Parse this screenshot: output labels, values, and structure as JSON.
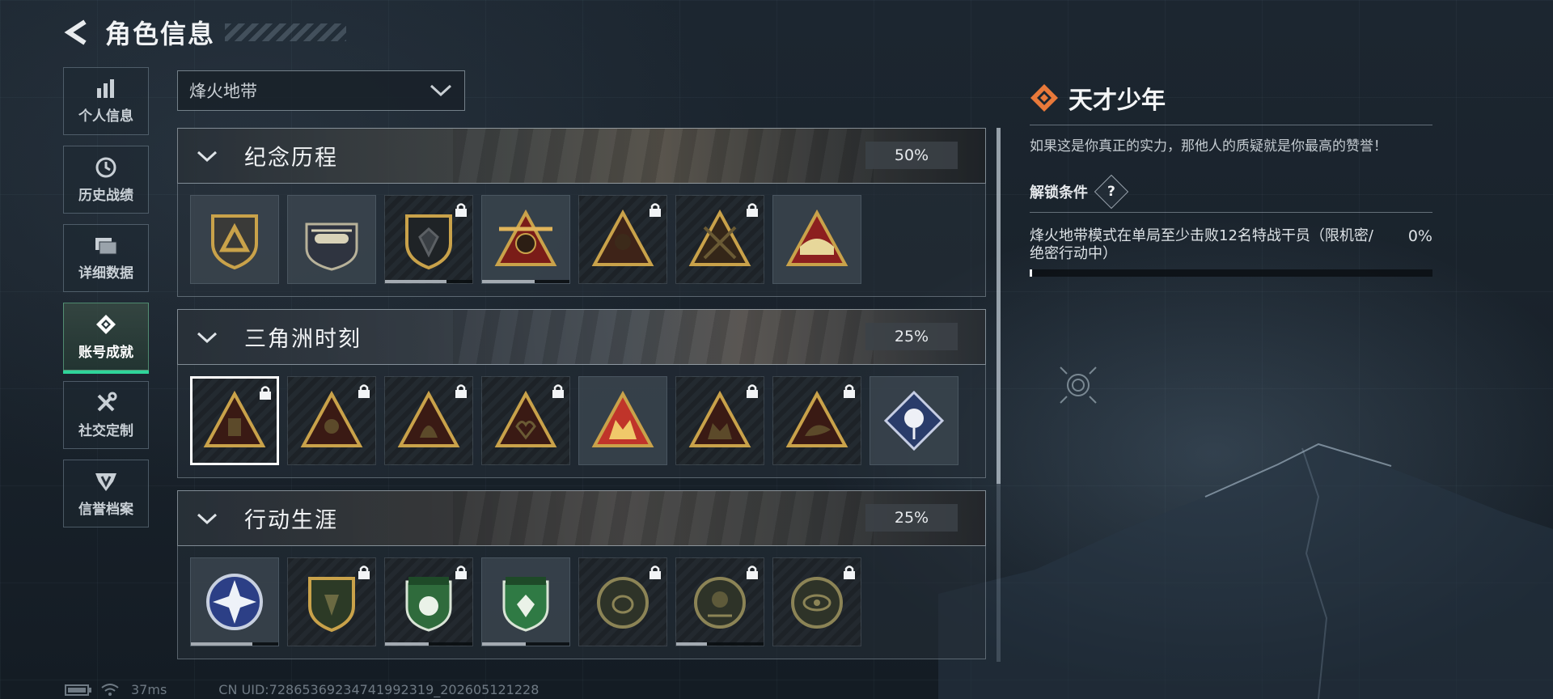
{
  "header": {
    "title": "角色信息"
  },
  "sidebar": {
    "items": [
      {
        "label": "个人信息",
        "icon": "bar-chart-icon",
        "active": false
      },
      {
        "label": "历史战绩",
        "icon": "clock-icon",
        "active": false
      },
      {
        "label": "详细数据",
        "icon": "folder-icon",
        "active": false
      },
      {
        "label": "账号成就",
        "icon": "achievement-icon",
        "active": true
      },
      {
        "label": "社交定制",
        "icon": "tools-icon",
        "active": false
      },
      {
        "label": "信誉档案",
        "icon": "shield-emblem-icon",
        "active": false
      }
    ]
  },
  "mode_select": {
    "value": "烽火地带"
  },
  "sections": [
    {
      "title": "纪念历程",
      "percent": "50%",
      "badges": [
        {
          "emblem": "triangle-shield-emblem",
          "locked": false,
          "progress": 0
        },
        {
          "emblem": "helicopter-emblem",
          "locked": false,
          "progress": 0
        },
        {
          "emblem": "hex-shield-emblem",
          "locked": true,
          "progress": 0.7
        },
        {
          "emblem": "wing-59-emblem",
          "locked": false,
          "progress": 0.6
        },
        {
          "emblem": "operator-portrait-emblem",
          "locked": true,
          "progress": 0
        },
        {
          "emblem": "crossed-swords-emblem",
          "locked": true,
          "progress": 0
        },
        {
          "emblem": "stacked-sandbags-emblem",
          "locked": false,
          "progress": 0
        }
      ]
    },
    {
      "title": "三角洲时刻",
      "percent": "25%",
      "badges": [
        {
          "emblem": "delta-portrait-emblem",
          "locked": true,
          "progress": 0,
          "selected": true
        },
        {
          "emblem": "delta-skull-emblem",
          "locked": true,
          "progress": 0
        },
        {
          "emblem": "delta-figure-emblem",
          "locked": true,
          "progress": 0
        },
        {
          "emblem": "delta-heart-emblem",
          "locked": true,
          "progress": 0
        },
        {
          "emblem": "delta-team-gold-emblem",
          "locked": false,
          "progress": 0
        },
        {
          "emblem": "delta-soldiers-emblem",
          "locked": true,
          "progress": 0
        },
        {
          "emblem": "delta-beast-emblem",
          "locked": true,
          "progress": 0
        },
        {
          "emblem": "rose-diamond-emblem",
          "locked": false,
          "progress": 0
        }
      ]
    },
    {
      "title": "行动生涯",
      "percent": "25%",
      "badges": [
        {
          "emblem": "blue-star-emblem",
          "locked": false,
          "progress": 0.7
        },
        {
          "emblem": "dark-green-shield-emblem",
          "locked": true,
          "progress": 0
        },
        {
          "emblem": "green-shield-emblem",
          "locked": true,
          "progress": 0.5
        },
        {
          "emblem": "green-crystal-shield-emblem",
          "locked": false,
          "progress": 0.5
        },
        {
          "emblem": "round-fist-emblem",
          "locked": true,
          "progress": 0
        },
        {
          "emblem": "round-skull-emblem",
          "locked": true,
          "progress": 0.35
        },
        {
          "emblem": "round-eye-emblem",
          "locked": true,
          "progress": 0
        }
      ]
    }
  ],
  "detail": {
    "name": "天才少年",
    "description": "如果这是你真正的实力，那他人的质疑就是你最高的赞誉！",
    "condition_title": "解锁条件",
    "help_label": "?",
    "condition_text": "烽火地带模式在单局至少击败12名特战干员（限机密/绝密行动中）",
    "condition_percent": "0%",
    "condition_progress": 0
  },
  "status": {
    "ping": "37ms",
    "uid": "CN UID:7286536923474199231​9_202605121228"
  },
  "colors": {
    "accent_green": "#2fd49a",
    "emblem_orange": "#e8793a",
    "gold": "#c9a24a"
  }
}
